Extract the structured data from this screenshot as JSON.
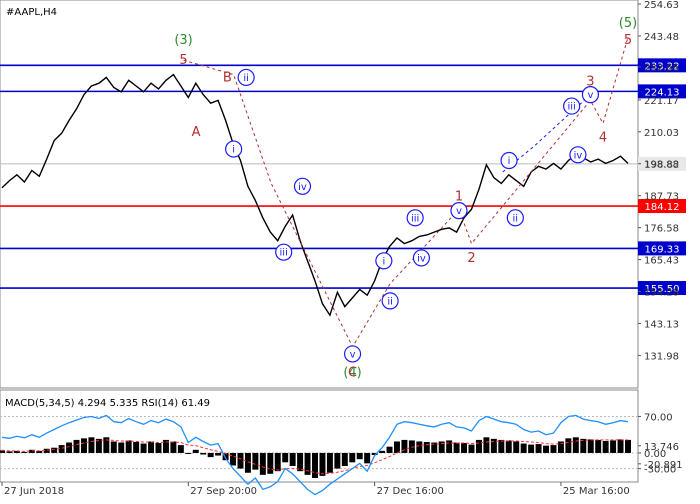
{
  "header": {
    "symbol_label": "#AAPL,H4"
  },
  "indicator_label": "MACD(5,34,5) 4.294 5.335 RSI(14) 61.49",
  "colors": {
    "support_line": "#0000cc",
    "pivot_line": "#ff0000",
    "price_line": "#000000",
    "current_price_line": "#bbbbbb",
    "wave_red": "#b03030",
    "wave_green": "#2e8b2e",
    "wave_blue": "#1a1aff",
    "rsi_line": "#1e90ff",
    "macd_hist": "#000000",
    "macd_signal": "#ff3030"
  },
  "chart_data": [
    {
      "type": "line",
      "symbol": "#AAPL",
      "timeframe": "H4",
      "ylim": [
        122.0,
        254.63
      ],
      "price_axis_ticks": [
        "254.63",
        "243.48",
        "232.66",
        "221.17",
        "210.03",
        "198.88",
        "187.73",
        "176.58",
        "165.43",
        "154.28",
        "143.13",
        "131.98"
      ],
      "x_ticks": [
        "27 Jun 2018",
        "27 Sep 20:00",
        "27 Dec 16:00",
        "25 Mar 16:00"
      ],
      "x_tick_index": [
        0,
        25,
        50,
        75
      ],
      "n_points": 85,
      "price": [
        190.5,
        193.0,
        195.0,
        192.5,
        196.5,
        194.5,
        200.5,
        207.0,
        209.5,
        214.0,
        218.0,
        223.0,
        226.0,
        227.0,
        229.0,
        225.5,
        224.0,
        228.0,
        226.0,
        224.0,
        227.0,
        225.0,
        228.0,
        230.0,
        226.0,
        222.0,
        227.0,
        223.0,
        220.0,
        221.0,
        214.0,
        206.0,
        200.0,
        191.0,
        186.0,
        180.0,
        175.0,
        172.0,
        177.0,
        181.0,
        172.0,
        165.0,
        158.0,
        150.0,
        146.0,
        154.0,
        149.0,
        152.0,
        155.0,
        153.0,
        158.0,
        165.0,
        170.0,
        173.0,
        171.0,
        172.0,
        173.5,
        174.0,
        175.0,
        176.0,
        176.5,
        175.0,
        180.0,
        183.0,
        190.0,
        198.5,
        194.0,
        192.0,
        195.0,
        193.0,
        191.0,
        196.0,
        198.0,
        197.0,
        199.0,
        197.0,
        200.0,
        202.0,
        201.0,
        199.5,
        200.5,
        199.0,
        200.0,
        201.5,
        199.0
      ],
      "levels": [
        {
          "value": 233.22,
          "label": "233.22",
          "kind": "resistance"
        },
        {
          "value": 224.13,
          "label": "224.13",
          "kind": "resistance"
        },
        {
          "value": 198.82,
          "label": "198.82",
          "kind": "current"
        },
        {
          "value": 184.12,
          "label": "184.12",
          "kind": "pivot"
        },
        {
          "value": 169.33,
          "label": "169.33",
          "kind": "support"
        },
        {
          "value": 155.5,
          "label": "155.50",
          "kind": "support"
        }
      ],
      "wave_labels": [
        {
          "text": "(3)",
          "x": 29.0,
          "y": 242.0,
          "color": "green"
        },
        {
          "text": "5",
          "x": 29.0,
          "y": 235.0,
          "color": "red"
        },
        {
          "text": "B",
          "x": 36.0,
          "y": 229.0,
          "color": "red"
        },
        {
          "text": "ii",
          "x": 39.0,
          "y": 229.0,
          "color": "blue",
          "circle": true
        },
        {
          "text": "A",
          "x": 31.0,
          "y": 210.0,
          "color": "red"
        },
        {
          "text": "i",
          "x": 37.0,
          "y": 204.0,
          "color": "blue",
          "circle": true
        },
        {
          "text": "iv",
          "x": 48.0,
          "y": 191.0,
          "color": "blue",
          "circle": true
        },
        {
          "text": "iii",
          "x": 45.0,
          "y": 168.0,
          "color": "blue",
          "circle": true
        },
        {
          "text": "v",
          "x": 56.0,
          "y": 132.5,
          "color": "blue",
          "circle": true
        },
        {
          "text": "(4)",
          "x": 56.0,
          "y": 126.0,
          "color": "green"
        },
        {
          "text": "C",
          "x": 56.0,
          "y": 126.0,
          "color": "red"
        },
        {
          "text": "i",
          "x": 61.0,
          "y": 165.0,
          "color": "blue",
          "circle": true
        },
        {
          "text": "ii",
          "x": 62.0,
          "y": 151.0,
          "color": "blue",
          "circle": true
        },
        {
          "text": "iii",
          "x": 66.0,
          "y": 180.0,
          "color": "blue",
          "circle": true
        },
        {
          "text": "iv",
          "x": 67.0,
          "y": 166.0,
          "color": "blue",
          "circle": true
        },
        {
          "text": "1",
          "x": 73.0,
          "y": 187.5,
          "color": "red"
        },
        {
          "text": "v",
          "x": 73.0,
          "y": 182.5,
          "color": "blue",
          "circle": true
        },
        {
          "text": "2",
          "x": 75.0,
          "y": 166.0,
          "color": "red"
        },
        {
          "text": "i",
          "x": 81.0,
          "y": 200.0,
          "color": "blue",
          "circle": true
        },
        {
          "text": "ii",
          "x": 82.0,
          "y": 180.0,
          "color": "blue",
          "circle": true
        },
        {
          "text": "3",
          "x": 94.0,
          "y": 227.5,
          "color": "red"
        },
        {
          "text": "v",
          "x": 94.0,
          "y": 223.0,
          "color": "blue",
          "circle": true
        },
        {
          "text": "iii",
          "x": 91.0,
          "y": 219.0,
          "color": "blue",
          "circle": true
        },
        {
          "text": "iv",
          "x": 92.0,
          "y": 202.0,
          "color": "blue",
          "circle": true
        },
        {
          "text": "4",
          "x": 96.0,
          "y": 208.0,
          "color": "red"
        },
        {
          "text": "(5)",
          "x": 100.0,
          "y": 248.0,
          "color": "green"
        },
        {
          "text": "5",
          "x": 100.0,
          "y": 242.0,
          "color": "red"
        }
      ],
      "wave_paths": [
        {
          "color": "red",
          "points": [
            [
              29,
              235
            ],
            [
              37,
              230
            ],
            [
              43,
              192
            ],
            [
              56,
              135
            ],
            [
              62,
              157
            ],
            [
              73,
              183
            ],
            [
              75,
              171
            ],
            [
              94,
              221
            ],
            [
              96,
              213
            ],
            [
              100,
              243
            ]
          ]
        },
        {
          "color": "blue",
          "points": [
            [
              80,
              196
            ],
            [
              85,
              205
            ],
            [
              90,
              215
            ],
            [
              93,
              221
            ]
          ]
        }
      ]
    },
    {
      "type": "indicator",
      "name": "MACD(5,34,5) / RSI(14)",
      "macd_main": 4.294,
      "macd_signal": 5.335,
      "rsi": 61.49,
      "ylim": [
        -50.0,
        115.0
      ],
      "axis_ticks": [
        "13.746",
        "70.00",
        "0.00",
        "-30.00",
        "-20.891"
      ],
      "levels": [
        70.0,
        0.0,
        -30.0
      ],
      "rsi_values": [
        30,
        28,
        32,
        29,
        35,
        30,
        38,
        45,
        52,
        58,
        63,
        68,
        70,
        66,
        72,
        60,
        58,
        66,
        60,
        55,
        62,
        58,
        65,
        60,
        50,
        20,
        30,
        22,
        15,
        18,
        -10,
        -30,
        -45,
        -60,
        -48,
        -70,
        -65,
        -55,
        -30,
        -40,
        -55,
        -70,
        -80,
        -72,
        -60,
        -50,
        -40,
        -30,
        -20,
        -35,
        -5,
        10,
        30,
        55,
        60,
        58,
        55,
        52,
        50,
        55,
        58,
        50,
        48,
        42,
        62,
        70,
        65,
        60,
        58,
        55,
        45,
        40,
        42,
        35,
        38,
        58,
        70,
        72,
        65,
        62,
        60,
        55,
        58,
        62,
        60
      ],
      "macd_values": [
        5,
        3,
        4,
        2,
        6,
        4,
        8,
        10,
        15,
        20,
        25,
        28,
        30,
        27,
        30,
        22,
        20,
        24,
        21,
        18,
        22,
        19,
        25,
        22,
        15,
        -2,
        6,
        -3,
        -8,
        -5,
        -14,
        -24,
        -30,
        -38,
        -32,
        -42,
        -40,
        -35,
        -18,
        -25,
        -35,
        -42,
        -48,
        -44,
        -38,
        -30,
        -25,
        -18,
        -12,
        -20,
        -4,
        4,
        12,
        22,
        25,
        24,
        22,
        21,
        20,
        22,
        24,
        20,
        19,
        16,
        25,
        30,
        27,
        25,
        24,
        22,
        18,
        16,
        17,
        14,
        15,
        22,
        28,
        30,
        27,
        26,
        25,
        23,
        24,
        26,
        25
      ],
      "signal_values": [
        5,
        4,
        4,
        3,
        4,
        4,
        5,
        7,
        9,
        12,
        16,
        19,
        22,
        24,
        25,
        24,
        23,
        23,
        22,
        21,
        21,
        20,
        21,
        21,
        20,
        15,
        14,
        10,
        6,
        3,
        -1,
        -6,
        -11,
        -17,
        -22,
        -27,
        -31,
        -33,
        -30,
        -30,
        -31,
        -34,
        -38,
        -40,
        -39,
        -37,
        -34,
        -30,
        -26,
        -24,
        -19,
        -13,
        -7,
        0,
        6,
        11,
        14,
        16,
        17,
        18,
        19,
        19,
        19,
        18,
        19,
        21,
        22,
        23,
        23,
        23,
        22,
        21,
        20,
        18,
        17,
        18,
        20,
        23,
        24,
        25,
        25,
        25,
        25,
        25,
        25
      ]
    }
  ]
}
